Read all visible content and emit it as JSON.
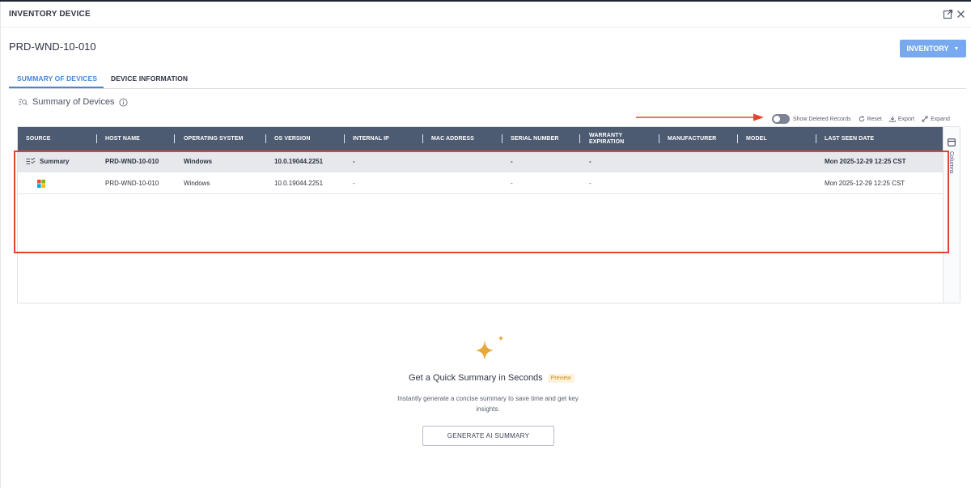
{
  "window": {
    "title": "INVENTORY DEVICE",
    "open_icon": "external-link-icon",
    "close_icon": "close-icon"
  },
  "device": {
    "name": "PRD-WND-10-010",
    "inventory_button": "INVENTORY"
  },
  "tabs": [
    {
      "label": "SUMMARY OF DEVICES",
      "active": true
    },
    {
      "label": "DEVICE INFORMATION",
      "active": false
    }
  ],
  "section": {
    "title": "Summary of Devices",
    "title_icon": "list-search-icon",
    "info_icon": "info-icon"
  },
  "toolbar": {
    "show_deleted_label": "Show Deleted Records",
    "show_deleted_on": false,
    "reset_label": "Reset",
    "export_label": "Export",
    "expand_label": "Expand"
  },
  "grid": {
    "columns": [
      "SOURCE",
      "HOST NAME",
      "OPERATING SYSTEM",
      "OS VERSION",
      "INTERNAL IP",
      "MAC ADDRESS",
      "SERIAL NUMBER",
      "WARRANTY EXPIRATION",
      "MANUFACTURER",
      "MODEL",
      "LAST SEEN DATE"
    ],
    "rows": [
      {
        "source": "Summary",
        "source_icon": "summary-list-icon",
        "host_name": "PRD-WND-10-010",
        "os": "Windows",
        "os_version": "10.0.19044.2251",
        "internal_ip": "-",
        "mac_address": "",
        "serial_number": "-",
        "warranty": "-",
        "manufacturer": "",
        "model": "",
        "last_seen": "Mon 2025-12-29 12:25 CST"
      },
      {
        "source": "",
        "source_icon": "windows-logo-icon",
        "host_name": "PRD-WND-10-010",
        "os": "Windows",
        "os_version": "10.0.19044.2251",
        "internal_ip": "-",
        "mac_address": "",
        "serial_number": "-",
        "warranty": "-",
        "manufacturer": "",
        "model": "",
        "last_seen": "Mon 2025-12-29 12:25 CST"
      }
    ],
    "side_panel_label": "Columns"
  },
  "ai_summary": {
    "title": "Get a Quick Summary in Seconds",
    "badge": "Preview",
    "description": "Instantly generate a concise summary to save time and get key insights.",
    "button": "GENERATE AI SUMMARY",
    "icon": "sparkle-icon"
  },
  "colors": {
    "accent": "#4a86d8",
    "header_bg": "#4c5a72",
    "annotation": "#e2452f",
    "sparkle": "#e8a83a"
  }
}
